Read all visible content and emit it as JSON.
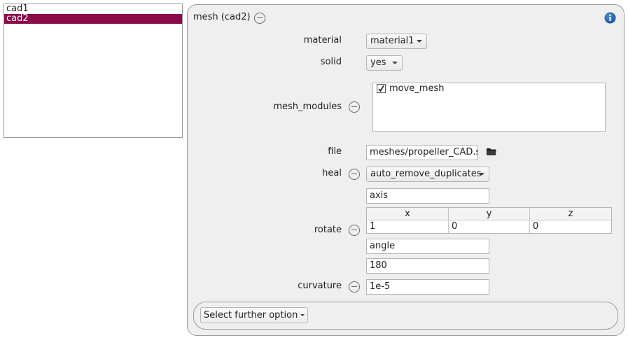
{
  "tree": {
    "items": [
      "cad1",
      "cad2"
    ],
    "selected_index": 1
  },
  "panel": {
    "title": "mesh (cad2)",
    "info_icon": "info-icon",
    "material": {
      "label": "material",
      "value": "material1"
    },
    "solid": {
      "label": "solid",
      "value": "yes"
    },
    "mesh_modules": {
      "label": "mesh_modules",
      "items": [
        {
          "name": "move_mesh",
          "checked": true
        }
      ]
    },
    "file": {
      "label": "file",
      "value": "meshes/propeller_CAD.stl",
      "browse_icon": "folder-icon"
    },
    "heal": {
      "label": "heal",
      "value": "auto_remove_duplicates"
    },
    "rotate": {
      "label": "rotate",
      "axis_label": "axis",
      "columns": [
        "x",
        "y",
        "z"
      ],
      "values": [
        "1",
        "0",
        "0"
      ],
      "angle_label": "angle",
      "angle_value": "180"
    },
    "curvature": {
      "label": "curvature",
      "value": "1e-5"
    },
    "further_option": {
      "label": "Select further option"
    }
  },
  "colors": {
    "selection": "#8b0a4a",
    "info_icon": "#1a5fb4"
  }
}
